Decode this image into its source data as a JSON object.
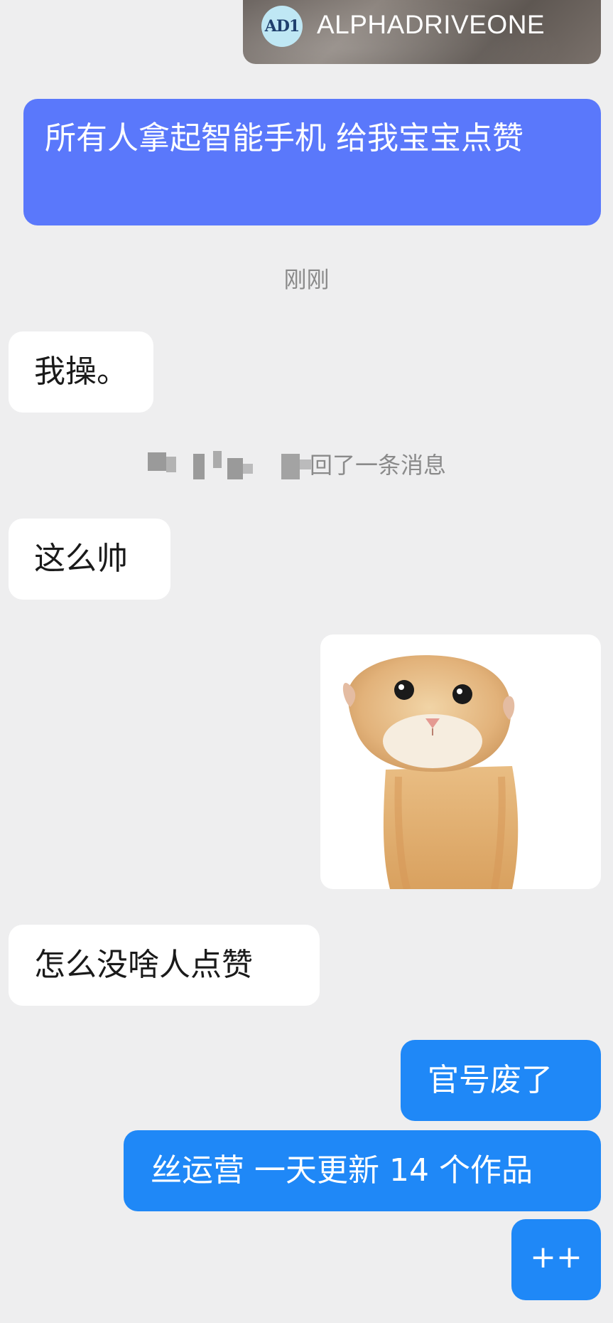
{
  "shared_card": {
    "logo_text": "AD1",
    "account_name": "ALPHADRIVEONE"
  },
  "messages": [
    {
      "side": "outgoing",
      "text": "所有人拿起智能手机 给我宝宝点赞"
    },
    {
      "side": "incoming",
      "text": "我操。"
    },
    {
      "side": "incoming",
      "text": "这么帅"
    },
    {
      "side": "incoming",
      "type": "sticker",
      "icon": "cat-sticker-icon"
    },
    {
      "side": "incoming",
      "text": "怎么没啥人点赞"
    },
    {
      "side": "outgoing",
      "text": "官号废了"
    },
    {
      "side": "outgoing",
      "text": "丝运营 一天更新 14 个作品"
    },
    {
      "side": "outgoing",
      "text": "++"
    }
  ],
  "timestamp": "刚刚",
  "recall_notice": "回了一条消息",
  "colors": {
    "background": "#eeeeef",
    "incoming_bubble": "#ffffff",
    "outgoing_bubble": "#1f88f7",
    "highlight_bubble": "#5a78fb",
    "system_text": "#8a8a8a"
  }
}
